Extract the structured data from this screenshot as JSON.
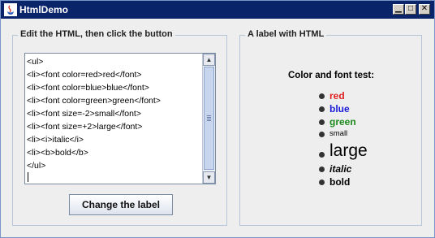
{
  "window": {
    "title": "HtmlDemo"
  },
  "left_panel": {
    "title": "Edit the HTML, then click the button",
    "code_lines": [
      "<ul>",
      "<li><font color=red>red</font>",
      "<li><font color=blue>blue</font>",
      "<li><font color=green>green</font>",
      "<li><font size=-2>small</font>",
      "<li><font size=+2>large</font>",
      "<li><i>italic</i>",
      "<li><b>bold</b>",
      "</ul>"
    ],
    "button_label": "Change the label"
  },
  "right_panel": {
    "title": "A label with HTML",
    "heading": "Color and font test:",
    "items": [
      {
        "text": "red",
        "color": "#e02020"
      },
      {
        "text": "blue",
        "color": "#1a1ad8"
      },
      {
        "text": "green",
        "color": "#1a8a1a"
      },
      {
        "text": "small"
      },
      {
        "text": "large"
      },
      {
        "text": "italic"
      },
      {
        "text": "bold"
      }
    ]
  }
}
